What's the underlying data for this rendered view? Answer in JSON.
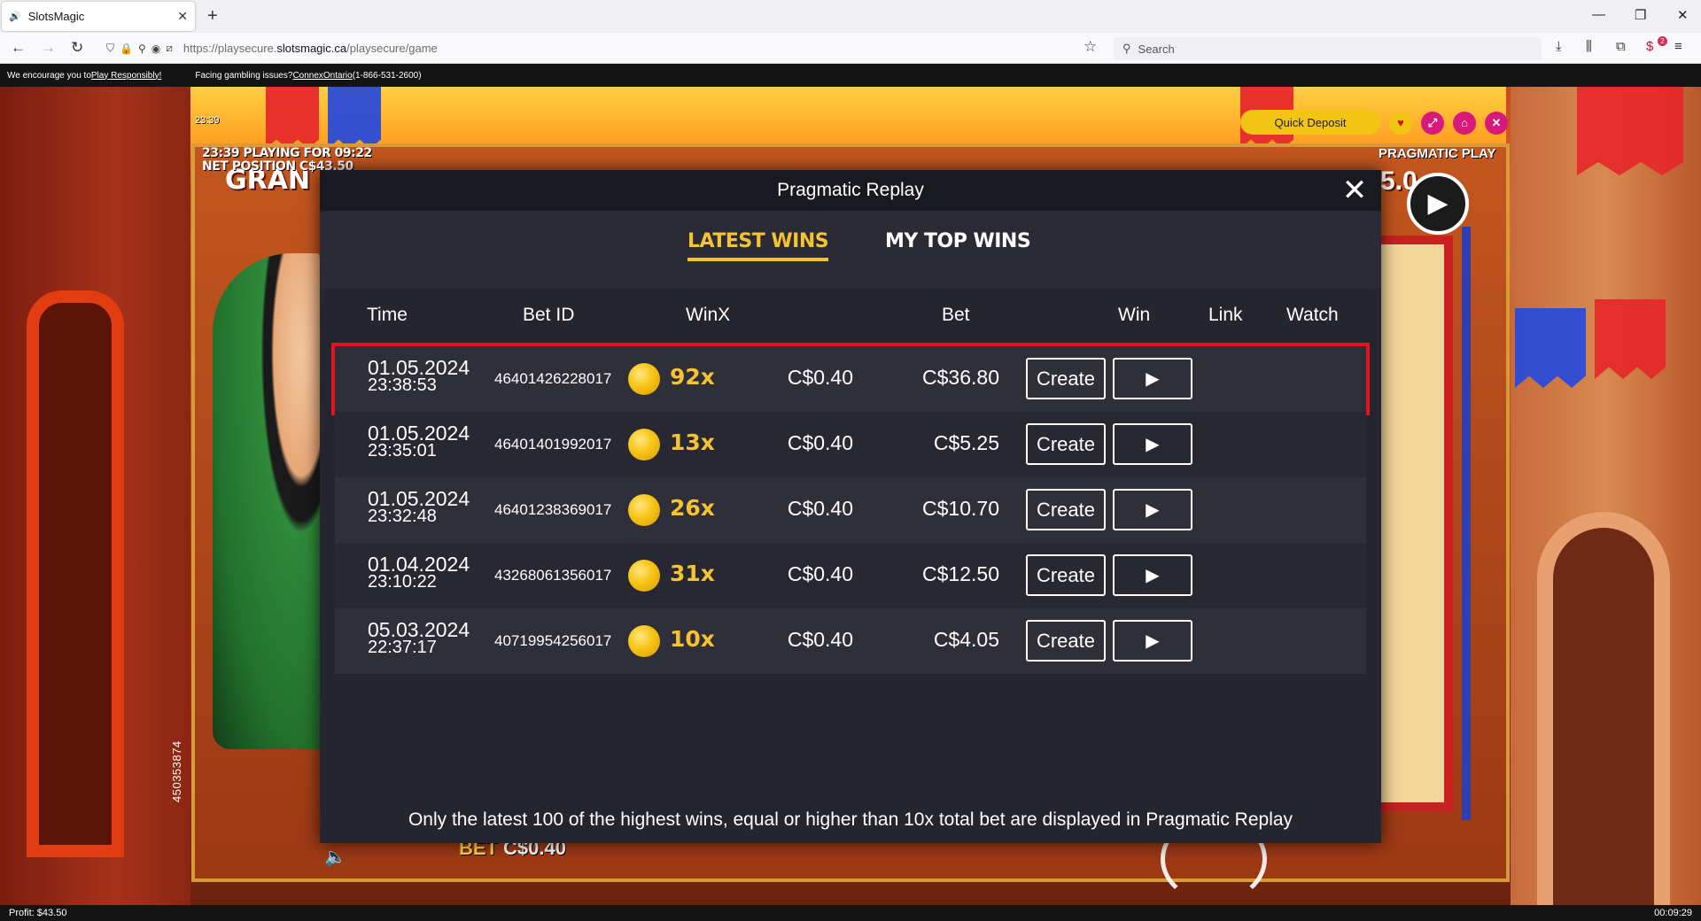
{
  "browser": {
    "tab_title": "SlotsMagic",
    "url_domain": "https://playsecure.",
    "url_host": "slotsmagic.ca",
    "url_path": "/playsecure/game",
    "search_placeholder": "Search",
    "addon_badge": "2"
  },
  "infobar": {
    "encourage_text": "We encourage you to ",
    "play_responsibly": "Play Responsibly!",
    "issues_text": "Facing gambling issues? ",
    "connex": "ConnexOntario",
    "phone": " (1-866-531-2600)"
  },
  "game": {
    "hud_time": "23:39",
    "playing_for": "23:39  PLAYING FOR 09:22",
    "net_position": "NET POSITION C$43.50",
    "grand_label": "GRAN",
    "pragmatic_label": "PRAGMATIC PLAY",
    "jackpot_partial": "5.0",
    "bet_label": "BET",
    "bet_value": "C$0.40",
    "vertical_id": "450353874",
    "quick_deposit": "Quick Deposit"
  },
  "modal": {
    "title": "Pragmatic Replay",
    "tabs": [
      {
        "label": "LATEST WINS",
        "active": true
      },
      {
        "label": "MY TOP WINS",
        "active": false
      }
    ],
    "columns": [
      "Time",
      "Bet ID",
      "WinX",
      "Bet",
      "Win",
      "Link",
      "Watch"
    ],
    "create_label": "Create",
    "rows": [
      {
        "date": "01.05.2024",
        "time": "23:38:53",
        "bet_id": "46401426228017",
        "winx": "92x",
        "bet": "C$0.40",
        "win": "C$36.80",
        "selected": true
      },
      {
        "date": "01.05.2024",
        "time": "23:35:01",
        "bet_id": "46401401992017",
        "winx": "13x",
        "bet": "C$0.40",
        "win": "C$5.25",
        "selected": false
      },
      {
        "date": "01.05.2024",
        "time": "23:32:48",
        "bet_id": "46401238369017",
        "winx": "26x",
        "bet": "C$0.40",
        "win": "C$10.70",
        "selected": false
      },
      {
        "date": "01.04.2024",
        "time": "23:10:22",
        "bet_id": "43268061356017",
        "winx": "31x",
        "bet": "C$0.40",
        "win": "C$12.50",
        "selected": false
      },
      {
        "date": "05.03.2024",
        "time": "22:37:17",
        "bet_id": "40719954256017",
        "winx": "10x",
        "bet": "C$0.40",
        "win": "C$4.05",
        "selected": false
      }
    ],
    "footer": "Only the latest 100 of the highest wins, equal or higher than 10x total bet are displayed in Pragmatic Replay"
  },
  "status": {
    "profit": "Profit: $43.50",
    "elapsed": "00:09:29"
  },
  "colors": {
    "accent_gold": "#f5c232",
    "selected_outline": "#e0141e",
    "quick_deposit": "#f2c414"
  }
}
